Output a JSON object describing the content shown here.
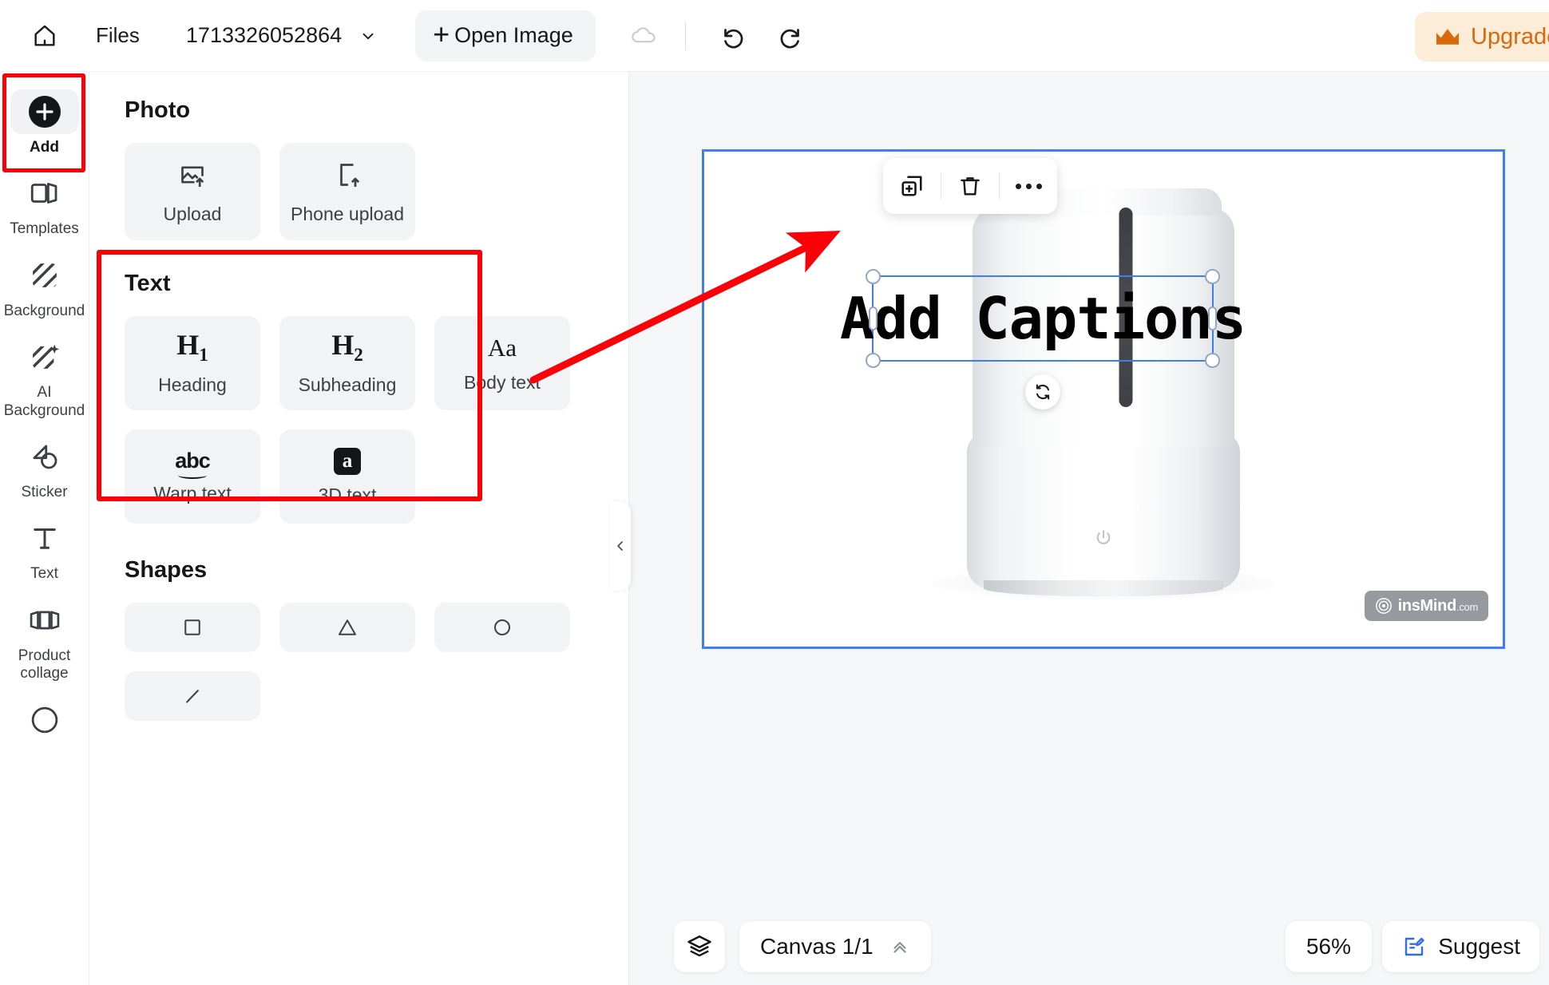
{
  "topbar": {
    "home_icon": "home-icon",
    "files_label": "Files",
    "document_name": "1713326052864",
    "open_image_label": "Open Image",
    "plus_glyph": "+",
    "cloud_icon": "cloud-save-icon",
    "undo_icon": "undo-icon",
    "redo_icon": "redo-icon",
    "upgrade_label": "Upgrade",
    "upgrade_color": "#d9690d",
    "upgrade_bg": "#fdecd8"
  },
  "rail": {
    "items": [
      {
        "label": "Add",
        "icon": "plus-circle-icon",
        "active": true
      },
      {
        "label": "Templates",
        "icon": "templates-icon",
        "active": false
      },
      {
        "label": "Background",
        "icon": "background-icon",
        "active": false
      },
      {
        "label": "AI\nBackground",
        "icon": "ai-background-icon",
        "active": false
      },
      {
        "label": "Sticker",
        "icon": "sticker-icon",
        "active": false
      },
      {
        "label": "Text",
        "icon": "text-t-icon",
        "active": false
      },
      {
        "label": "Product\ncollage",
        "icon": "product-collage-icon",
        "active": false
      }
    ]
  },
  "panel": {
    "photo": {
      "title": "Photo",
      "cards": [
        {
          "label": "Upload",
          "icon": "image-upload-icon"
        },
        {
          "label": "Phone upload",
          "icon": "phone-upload-icon"
        }
      ]
    },
    "text": {
      "title": "Text",
      "cards": [
        {
          "label": "Heading",
          "glyph": "H1",
          "icon": "h1-icon"
        },
        {
          "label": "Subheading",
          "glyph": "H2",
          "icon": "h2-icon"
        },
        {
          "label": "Body text",
          "glyph": "Aa",
          "icon": "body-text-icon"
        },
        {
          "label": "Warp text",
          "glyph": "abc",
          "icon": "warp-text-icon"
        },
        {
          "label": "3D text",
          "glyph": "a",
          "icon": "3d-text-icon"
        }
      ]
    },
    "shapes": {
      "title": "Shapes",
      "cards": [
        {
          "icon": "square-shape-icon"
        },
        {
          "icon": "triangle-shape-icon"
        },
        {
          "icon": "circle-shape-icon"
        },
        {
          "icon": "line-shape-icon"
        }
      ]
    },
    "collapse_icon": "chevron-left-icon"
  },
  "canvas": {
    "object_toolbar": [
      {
        "icon": "duplicate-icon"
      },
      {
        "icon": "delete-trash-icon"
      },
      {
        "icon": "more-options-icon"
      }
    ],
    "text_object": "Add Captions",
    "rotate_icon": "rotate-icon",
    "watermark": {
      "name": "insMind",
      "suffix": ".com",
      "icon": "insmind-logo-icon"
    }
  },
  "bottombar": {
    "layers_icon": "layers-icon",
    "canvas_pages": "Canvas 1/1",
    "pages_chevron": "chevron-up-icon",
    "zoom_level": "56%",
    "suggest_label": "Suggest",
    "suggest_icon": "suggest-edit-icon",
    "suggest_color": "#2f6fe4"
  },
  "annotations": {
    "color": "#fb0007",
    "boxes": [
      "add-button-highlight",
      "text-section-highlight"
    ],
    "arrow": "pointer-arrow"
  }
}
